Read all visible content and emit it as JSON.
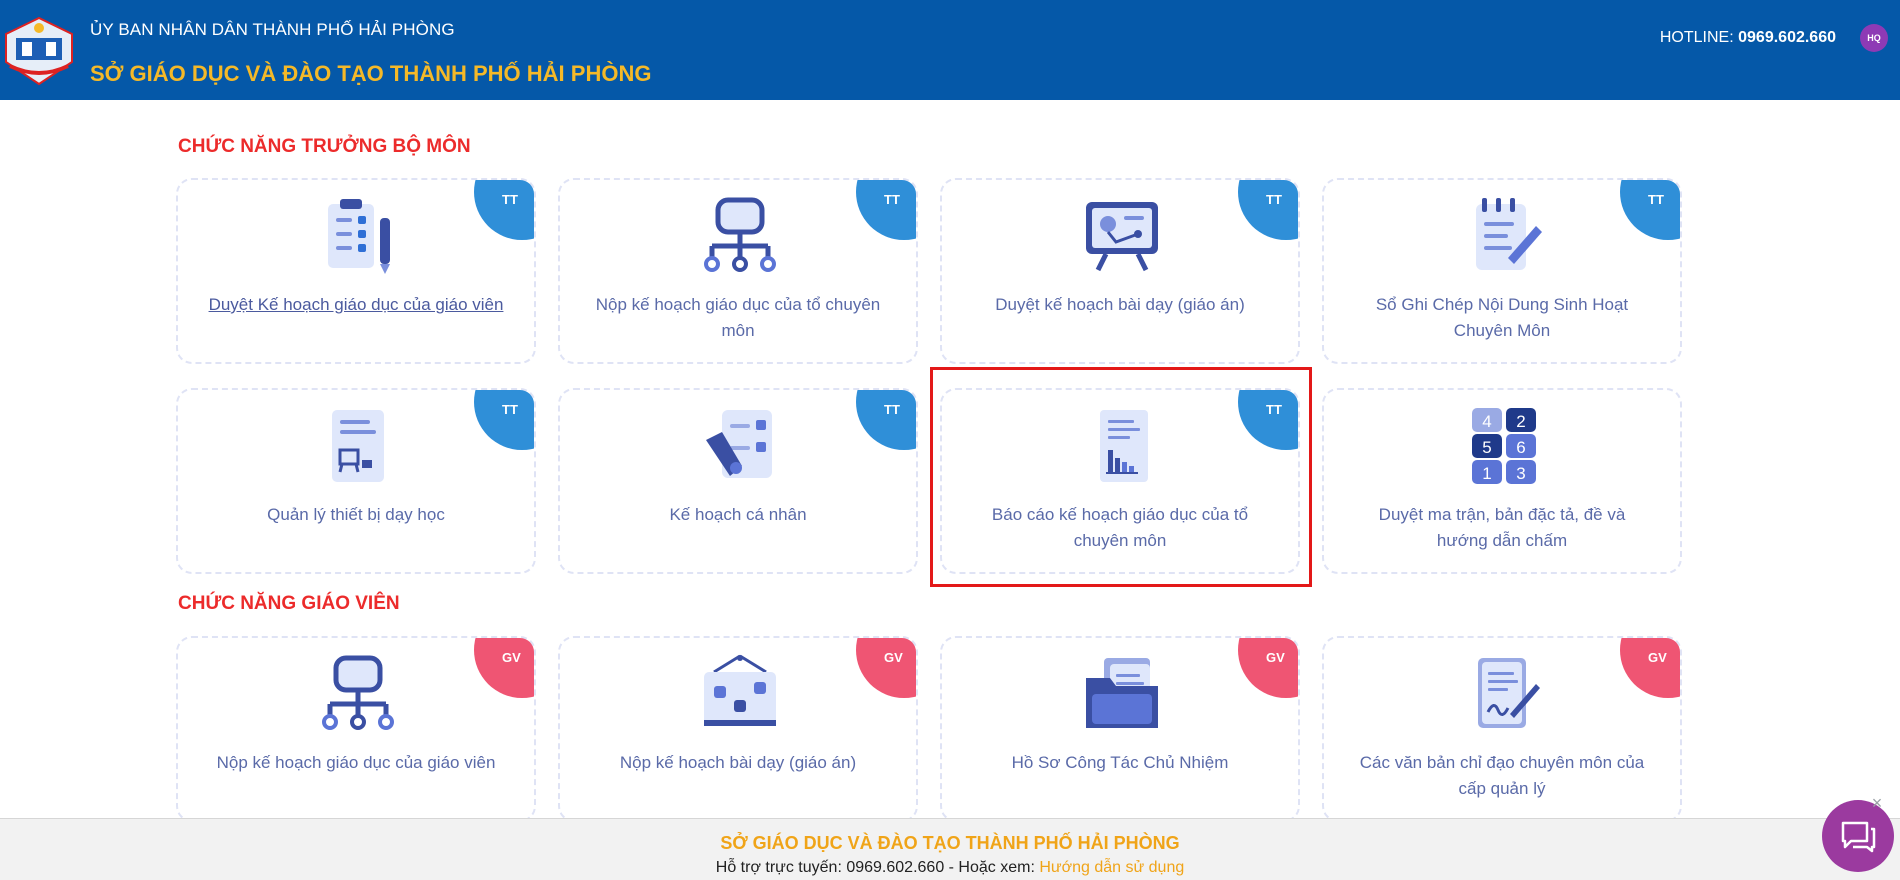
{
  "header": {
    "org_name": "ỦY BAN NHÂN DÂN THÀNH PHỐ HẢI PHÒNG",
    "dept_name": "SỞ GIÁO DỤC VÀ ĐÀO TẠO THÀNH PHỐ HẢI PHÒNG",
    "hotline_label": "HOTLINE:",
    "hotline_number": "0969.602.660",
    "avatar_initials": "HQ"
  },
  "sections": {
    "head_of_dept": {
      "title": "CHỨC NĂNG TRƯỞNG BỘ MÔN",
      "cards": [
        {
          "label": "Duyệt Kế hoạch giáo dục của giáo viên",
          "tag": "TT"
        },
        {
          "label": "Nộp kế hoạch giáo dục của tổ chuyên môn",
          "tag": "TT"
        },
        {
          "label": "Duyệt kế hoạch bài dạy (giáo án)",
          "tag": "TT"
        },
        {
          "label": "Sổ Ghi Chép Nội Dung Sinh Hoạt Chuyên Môn",
          "tag": "TT"
        },
        {
          "label": "Quản lý thiết bị dạy học",
          "tag": "TT"
        },
        {
          "label": "Kế hoạch cá nhân",
          "tag": "TT"
        },
        {
          "label": "Báo cáo kế hoạch giáo dục của tổ chuyên môn",
          "tag": "TT"
        },
        {
          "label": "Duyệt ma trận, bản đặc tả, đề và hướng dẫn chấm",
          "tag": ""
        }
      ]
    },
    "teacher": {
      "title": "CHỨC NĂNG GIÁO VIÊN",
      "cards": [
        {
          "label": "Nộp kế hoạch giáo dục của giáo viên",
          "tag": "GV"
        },
        {
          "label": "Nộp kế hoạch bài dạy (giáo án)",
          "tag": "GV"
        },
        {
          "label": "Hồ Sơ Công Tác Chủ Nhiệm",
          "tag": "GV"
        },
        {
          "label": "Các văn bản chỉ đạo chuyên môn của cấp quản lý",
          "tag": "GV"
        }
      ]
    }
  },
  "matrix_numbers": [
    "4",
    "2",
    "5",
    "6",
    "1",
    "3"
  ],
  "footer": {
    "title": "SỞ GIÁO DỤC VÀ ĐÀO TẠO THÀNH PHỐ HẢI PHÒNG",
    "support_text": "Hỗ trợ trực tuyến: 0969.602.660 - Hoặc xem: ",
    "guide_link": "Hướng dẫn sử dụng"
  },
  "colors": {
    "header_bg": "#0558a8",
    "accent_orange": "#f5b928",
    "section_red": "#ec2b2b",
    "tag_tt": "#2f8fd8",
    "tag_gv": "#ef5573",
    "highlight": "#e31818"
  },
  "icons": [
    "checklist-icon",
    "org-chart-icon",
    "presentation-icon",
    "notebook-icon",
    "equipment-doc-icon",
    "personal-plan-icon",
    "report-chart-icon",
    "number-matrix-icon",
    "org-chart-icon",
    "lesson-board-icon",
    "folder-icon",
    "signed-doc-icon",
    "chat-icon",
    "close-icon"
  ]
}
